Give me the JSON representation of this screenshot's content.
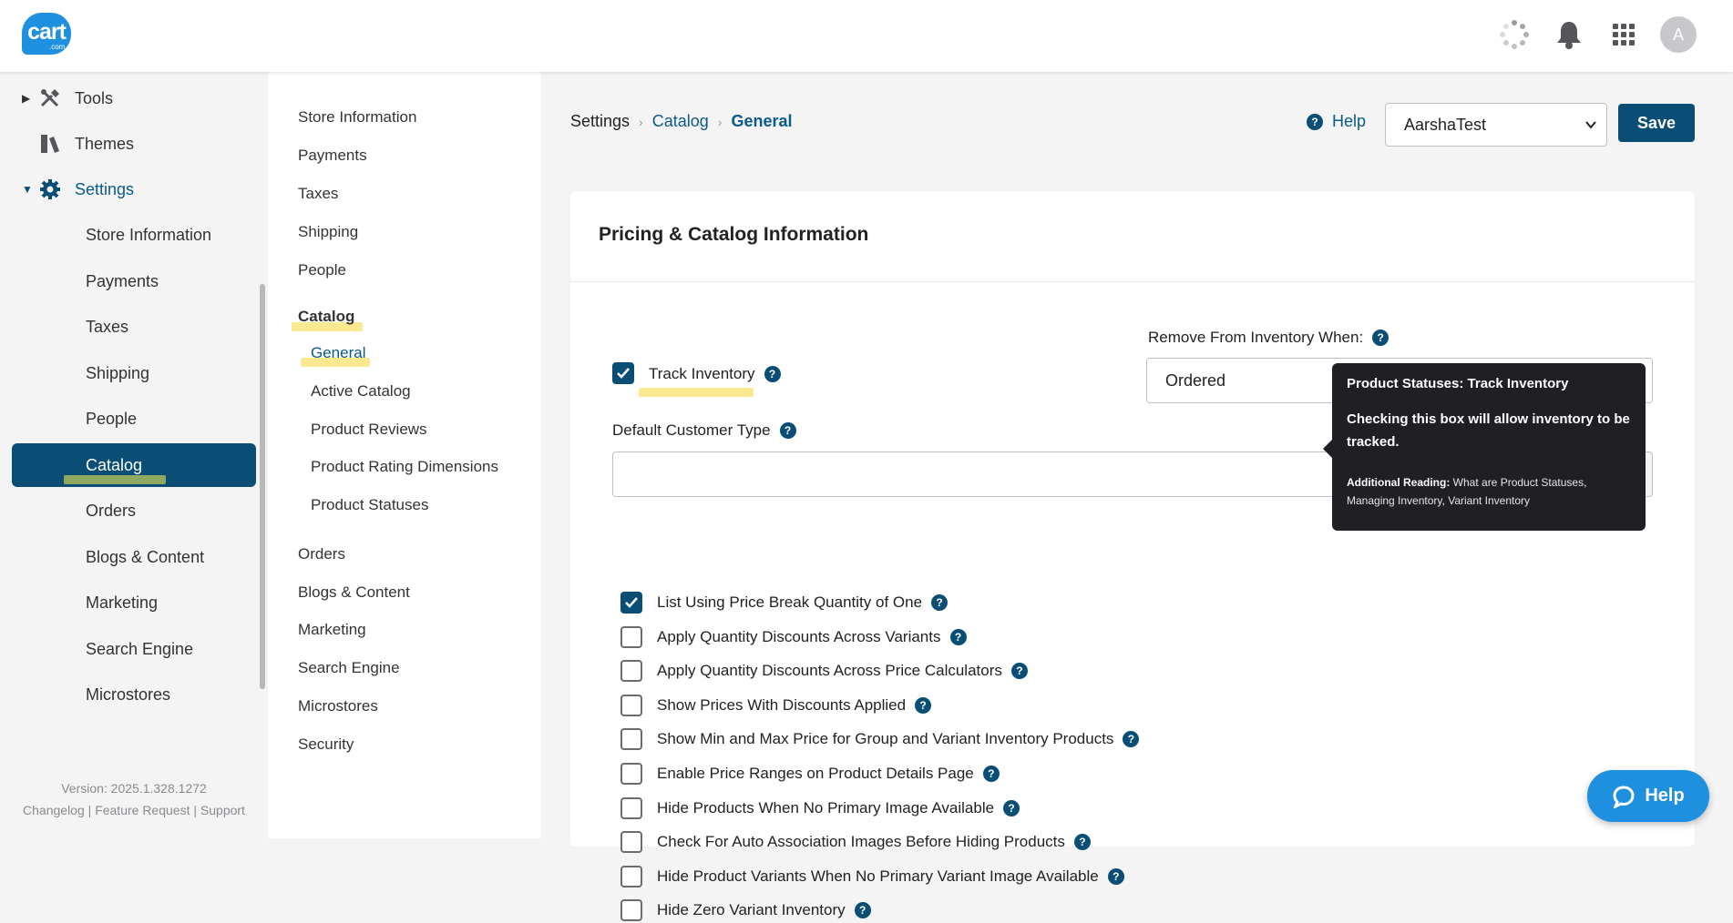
{
  "brand": {
    "logo_text": "cart",
    "logo_sub": ".com"
  },
  "topbar": {
    "avatar_initial": "A"
  },
  "sidebar": {
    "tools": "Tools",
    "themes": "Themes",
    "settings": "Settings",
    "items": [
      "Store Information",
      "Payments",
      "Taxes",
      "Shipping",
      "People",
      "Catalog",
      "Orders",
      "Blogs & Content",
      "Marketing",
      "Search Engine",
      "Microstores"
    ],
    "version": "Version: 2025.1.328.1272",
    "footer_links": [
      "Changelog",
      "Feature Request",
      "Support"
    ],
    "footer_sep": "|"
  },
  "subnav": {
    "top_items": [
      "Store Information",
      "Payments",
      "Taxes",
      "Shipping",
      "People"
    ],
    "catalog": "Catalog",
    "catalog_children": [
      "General",
      "Active Catalog",
      "Product Reviews",
      "Product Rating Dimensions",
      "Product Statuses"
    ],
    "bottom_items": [
      "Orders",
      "Blogs & Content",
      "Marketing",
      "Search Engine",
      "Microstores",
      "Security"
    ]
  },
  "breadcrumb": {
    "root": "Settings",
    "middle": "Catalog",
    "current": "General"
  },
  "header": {
    "help": "Help",
    "store_selected": "AarshaTest",
    "save": "Save"
  },
  "card": {
    "title": "Pricing & Catalog Information",
    "track_inventory": "Track Inventory",
    "remove_from_inventory_label": "Remove From Inventory When:",
    "remove_from_inventory_value": "Ordered",
    "default_customer_type_label": "Default Customer Type",
    "options": [
      {
        "label": "List Using Price Break Quantity of One",
        "checked": true
      },
      {
        "label": "Apply Quantity Discounts Across Variants",
        "checked": false
      },
      {
        "label": "Apply Quantity Discounts Across Price Calculators",
        "checked": false
      },
      {
        "label": "Show Prices With Discounts Applied",
        "checked": false
      },
      {
        "label": "Show Min and Max Price for Group and Variant Inventory Products",
        "checked": false
      },
      {
        "label": "Enable Price Ranges on Product Details Page",
        "checked": false
      },
      {
        "label": "Hide Products When No Primary Image Available",
        "checked": false
      },
      {
        "label": "Check For Auto Association Images Before Hiding Products",
        "checked": false
      },
      {
        "label": "Hide Product Variants When No Primary Variant Image Available",
        "checked": false
      },
      {
        "label": "Hide Zero Variant Inventory",
        "checked": false
      }
    ]
  },
  "tooltip": {
    "title": "Product Statuses: Track Inventory",
    "body": "Checking this box will allow inventory to be tracked.",
    "reading_label": "Additional Reading:",
    "links": [
      "What are Product Statuses",
      "Managing Inventory",
      "Variant Inventory"
    ],
    "sep": ","
  },
  "help_widget": {
    "label": "Help"
  },
  "colors": {
    "primary": "#0a4e75",
    "accent": "#1f8fe0",
    "tooltip_bg": "#1f1f24"
  },
  "icons": {
    "tools": "tools-icon",
    "themes": "themes-icon",
    "settings": "gear-icon",
    "bell": "bell-icon",
    "apps": "grid-icon",
    "loading": "spinner-icon"
  }
}
